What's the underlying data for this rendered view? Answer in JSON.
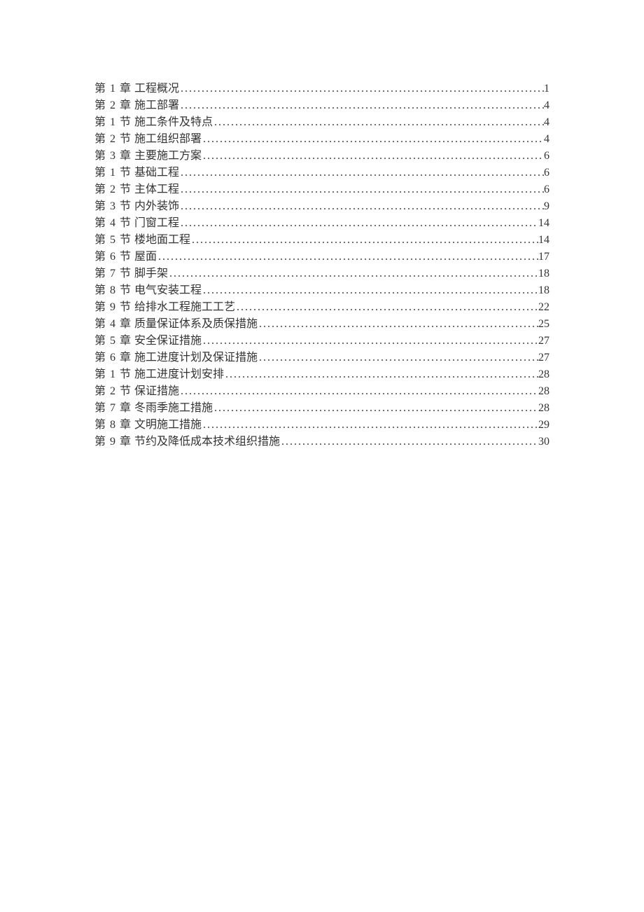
{
  "toc": [
    {
      "label": "第 1 章",
      "title": "工程概况",
      "page": "1"
    },
    {
      "label": "第 2 章",
      "title": "施工部署",
      "page": "4"
    },
    {
      "label": "第 1 节",
      "title": "施工条件及特点",
      "page": "4"
    },
    {
      "label": "第 2 节",
      "title": "施工组织部署",
      "page": "4"
    },
    {
      "label": "第 3 章",
      "title": "主要施工方案",
      "page": "6"
    },
    {
      "label": "第 1 节",
      "title": "基础工程",
      "page": "6"
    },
    {
      "label": "第 2 节",
      "title": "主体工程",
      "page": "6"
    },
    {
      "label": "第 3 节",
      "title": "内外装饰",
      "page": "9"
    },
    {
      "label": "第 4 节",
      "title": "门窗工程",
      "page": "14"
    },
    {
      "label": "第 5 节",
      "title": "楼地面工程",
      "page": "14"
    },
    {
      "label": "第 6 节",
      "title": "屋面",
      "page": "17"
    },
    {
      "label": "第 7 节",
      "title": "脚手架",
      "page": "18"
    },
    {
      "label": "第 8 节",
      "title": "电气安装工程",
      "page": "18"
    },
    {
      "label": "第 9 节",
      "title": "给排水工程施工工艺",
      "page": "22"
    },
    {
      "label": "第 4 章",
      "title": "质量保证体系及质保措施",
      "page": "25"
    },
    {
      "label": "第 5 章",
      "title": "安全保证措施",
      "page": "27"
    },
    {
      "label": "第 6 章",
      "title": "施工进度计划及保证措施",
      "page": "27"
    },
    {
      "label": "第 1 节",
      "title": "施工进度计划安排",
      "page": "28"
    },
    {
      "label": "第 2 节",
      "title": "保证措施",
      "page": "28"
    },
    {
      "label": "第 7 章",
      "title": "冬雨季施工措施",
      "page": "28"
    },
    {
      "label": "第 8 章",
      "title": "文明施工措施",
      "page": "29"
    },
    {
      "label": "第 9 章",
      "title": "节约及降低成本技术组织措施",
      "page": "30"
    }
  ]
}
